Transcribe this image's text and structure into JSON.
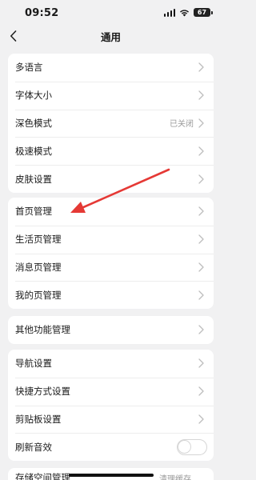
{
  "status_bar": {
    "time": "09:52",
    "battery": "67"
  },
  "nav": {
    "title": "通用"
  },
  "groups": [
    {
      "items": [
        {
          "label": "多语言"
        },
        {
          "label": "字体大小"
        },
        {
          "label": "深色模式",
          "value": "已关闭"
        },
        {
          "label": "极速模式"
        },
        {
          "label": "皮肤设置"
        }
      ]
    },
    {
      "items": [
        {
          "label": "首页管理"
        },
        {
          "label": "生活页管理"
        },
        {
          "label": "消息页管理"
        },
        {
          "label": "我的页管理"
        }
      ]
    },
    {
      "items": [
        {
          "label": "其他功能管理"
        }
      ]
    },
    {
      "items": [
        {
          "label": "导航设置"
        },
        {
          "label": "快捷方式设置"
        },
        {
          "label": "剪贴板设置"
        },
        {
          "label": "刷新音效",
          "toggle": false
        }
      ]
    }
  ],
  "bottom": {
    "label": "存储空间管理",
    "value": "清理缓存"
  },
  "colors": {
    "background": "#f1f1f2",
    "arrow": "#e53935"
  }
}
